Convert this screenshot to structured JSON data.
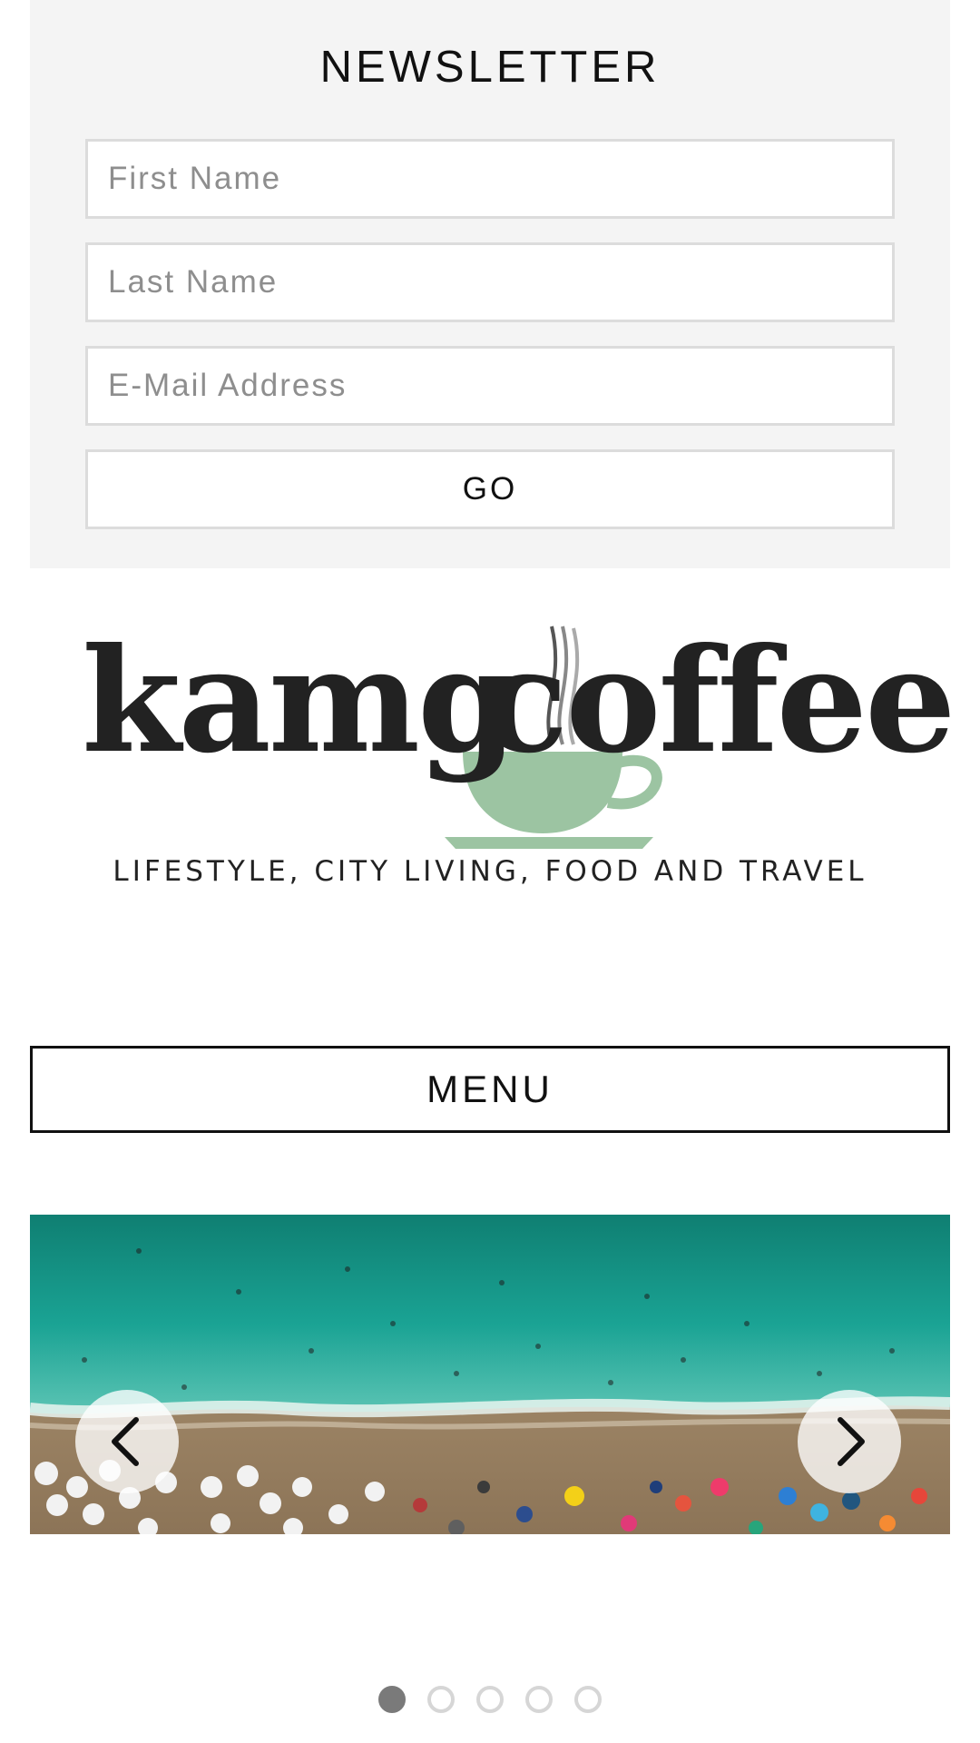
{
  "newsletter": {
    "title": "NEWSLETTER",
    "first_name_placeholder": "First Name",
    "last_name_placeholder": "Last Name",
    "email_placeholder": "E-Mail Address",
    "submit_label": "GO"
  },
  "logo": {
    "brand_left": "kamg",
    "brand_right": "coffee",
    "tagline": "LIFESTYLE, CITY LIVING, FOOD AND TRAVEL",
    "cup_color": "#9cc4a2"
  },
  "menu": {
    "label": "MENU"
  },
  "slider": {
    "prev_icon": "chevron-left-icon",
    "next_icon": "chevron-right-icon",
    "slide_count": 5,
    "active_slide": 1
  },
  "colors": {
    "newsletter_bg": "#f4f4f4",
    "sea": "#1aa394",
    "sand": "#9c8466"
  }
}
